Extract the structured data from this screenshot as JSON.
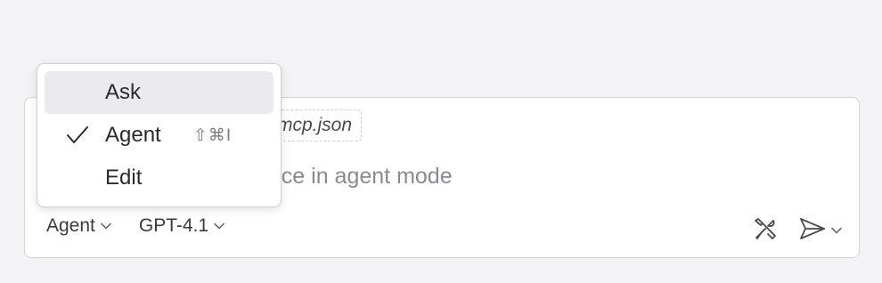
{
  "menu": {
    "items": [
      {
        "label": "Ask",
        "checked": false,
        "highlighted": true,
        "shortcut": ""
      },
      {
        "label": "Agent",
        "checked": true,
        "highlighted": false,
        "shortcut": "⇧⌘I"
      },
      {
        "label": "Edit",
        "checked": false,
        "highlighted": false,
        "shortcut": ""
      }
    ]
  },
  "chat": {
    "context_chip": "mcp.json",
    "placeholder": "pace in agent mode",
    "mode_picker": "Agent",
    "model_picker": "GPT-4.1"
  },
  "icons": {
    "check": "check-icon",
    "chevron": "chevron-down-icon",
    "tools": "tools-icon",
    "send": "send-icon"
  },
  "colors": {
    "background": "#f3f3f5",
    "menu_highlight": "#ebebee",
    "border": "#d4d4d8",
    "placeholder": "#8a8a90"
  }
}
